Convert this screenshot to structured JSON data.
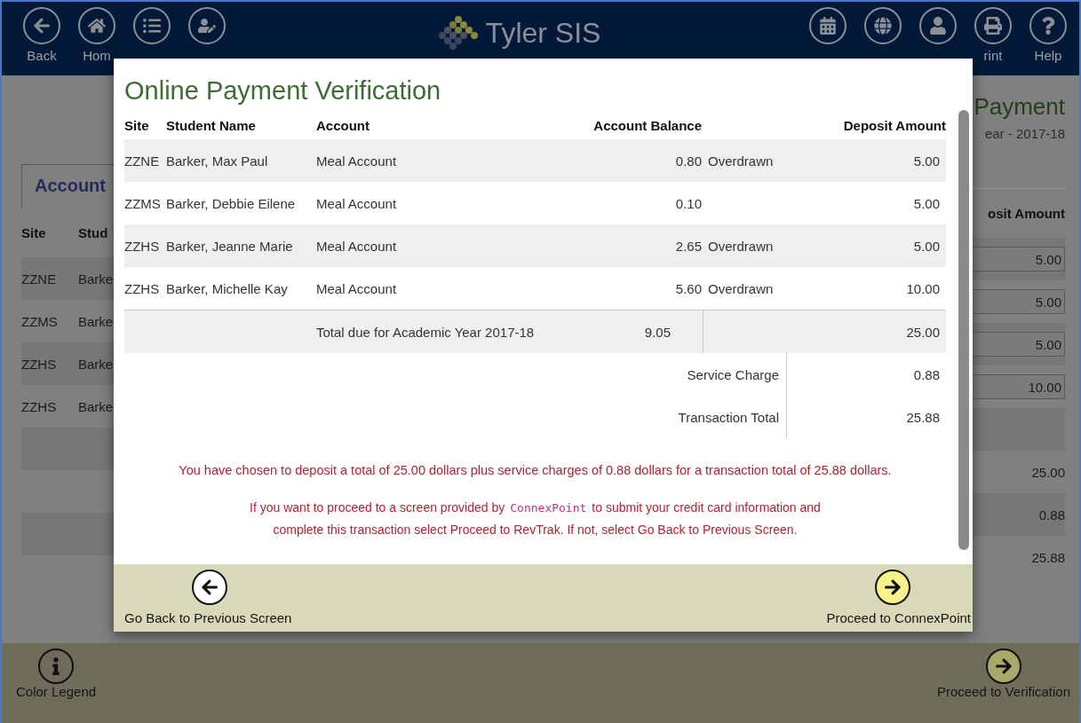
{
  "top_bar": {
    "logo": "Tyler SIS",
    "left_buttons": [
      {
        "kind": "back",
        "label": "Back"
      },
      {
        "kind": "home",
        "label": "Hom"
      },
      {
        "kind": "menu"
      },
      {
        "kind": "student"
      }
    ],
    "right_buttons": [
      {
        "kind": "calendar"
      },
      {
        "kind": "globe"
      },
      {
        "kind": "profile"
      },
      {
        "kind": "print",
        "label": "rint"
      },
      {
        "kind": "help",
        "label": "Help"
      }
    ]
  },
  "background_page": {
    "title": "Payment",
    "subtitle": "ear - 2017-18",
    "tab": "Account",
    "columns": [
      "Site",
      "Stud"
    ],
    "deposit_header": "osit Amount",
    "rows": [
      {
        "site": "ZZNE",
        "student": "Barke",
        "deposit": "5.00"
      },
      {
        "site": "ZZMS",
        "student": "Barke",
        "deposit": "5.00"
      },
      {
        "site": "ZZHS",
        "student": "Barke",
        "deposit": "5.00"
      },
      {
        "site": "ZZHS",
        "student": "Barke",
        "deposit": "10.00"
      }
    ],
    "totals": [
      "25.00",
      "0.88",
      "25.88"
    ]
  },
  "dialog": {
    "title": "Online Payment Verification",
    "columns": [
      "Site",
      "Student Name",
      "Account",
      "Account Balance",
      "Deposit Amount"
    ],
    "rows": [
      {
        "site": "ZZNE",
        "student": "Barker, Max Paul",
        "account": "Meal Account",
        "balance": "0.80",
        "status": "Overdrawn",
        "deposit": "5.00"
      },
      {
        "site": "ZZMS",
        "student": "Barker, Debbie Eilene",
        "account": "Meal Account",
        "balance": "0.10",
        "deposit": "5.00"
      },
      {
        "site": "ZZHS",
        "student": "Barker, Jeanne Marie",
        "account": "Meal Account",
        "balance": "2.65",
        "status": "Overdrawn",
        "deposit": "5.00"
      },
      {
        "site": "ZZHS",
        "student": "Barker, Michelle Kay",
        "account": "Meal Account",
        "balance": "5.60",
        "status": "Overdrawn",
        "deposit": "10.00"
      }
    ],
    "total": {
      "label": "Total due for Academic Year 2017-18",
      "balance": "9.05",
      "deposit": "25.00"
    },
    "summary": [
      {
        "label": "Service Charge",
        "value": "0.88"
      },
      {
        "label": "Transaction Total",
        "value": "25.88"
      }
    ],
    "message": "You have chosen to deposit a total of 25.00 dollars plus service charges of 0.88 dollars for a transaction total of 25.88 dollars.",
    "instruction": {
      "before": "If you want to proceed to a screen provided by",
      "provider": "ConnexPoint",
      "after": "to submit your credit card information and complete this transaction select Proceed to RevTrak. If not, select Go Back to Previous Screen."
    },
    "back_button": "Go Back to Previous Screen",
    "proceed_button": "Proceed to ConnexPoint"
  },
  "footer": {
    "left": "Color Legend",
    "right": "Proceed to Verification"
  }
}
